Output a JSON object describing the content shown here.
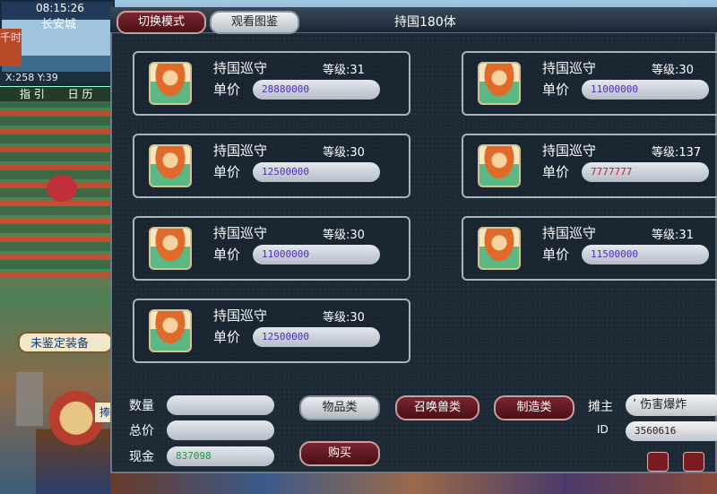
{
  "hud": {
    "time": "08:15:26",
    "city": "长安城",
    "coords": "X:258 Y:39",
    "nav": [
      "指 引",
      "日 历"
    ],
    "side_badge": "千时",
    "left_button": "未鉴定装备",
    "left_small_button": "捧"
  },
  "panel": {
    "title": "持国180体",
    "tabs": [
      "切换模式",
      "观看图鉴"
    ]
  },
  "labels": {
    "level": "等级:",
    "unit_price": "单价",
    "quantity": "数量",
    "total": "总价",
    "cash": "现金",
    "owner": "摊主",
    "id": "ID"
  },
  "pets": [
    {
      "name": "持国巡守",
      "level": "31",
      "price": "28880000",
      "price_color": "#4b2cbf"
    },
    {
      "name": "持国巡守",
      "level": "30",
      "price": "11000000",
      "price_color": "#4b2cbf"
    },
    {
      "name": "持国巡守",
      "level": "30",
      "price": "12500000",
      "price_color": "#4b2cbf"
    },
    {
      "name": "持国巡守",
      "level": "137",
      "price": "7777777",
      "price_color": "#d01818"
    },
    {
      "name": "持国巡守",
      "level": "30",
      "price": "11000000",
      "price_color": "#4b2cbf"
    },
    {
      "name": "持国巡守",
      "level": "31",
      "price": "11500000",
      "price_color": "#4b2cbf"
    },
    {
      "name": "持国巡守",
      "level": "30",
      "price": "12500000",
      "price_color": "#4b2cbf"
    }
  ],
  "form": {
    "quantity": "",
    "total": "",
    "cash": "837098",
    "cash_color": "#1e9a3a",
    "owner_name": "’ 伤害爆炸",
    "owner_id": "3560616"
  },
  "buttons": {
    "items": "物品类",
    "summon": "召唤兽类",
    "crafting": "制造类",
    "buy": "购买"
  },
  "icons": {
    "pet_avatar": "pet-avatar-icon",
    "corner_left": "close-icon",
    "corner_right": "menu-icon"
  }
}
